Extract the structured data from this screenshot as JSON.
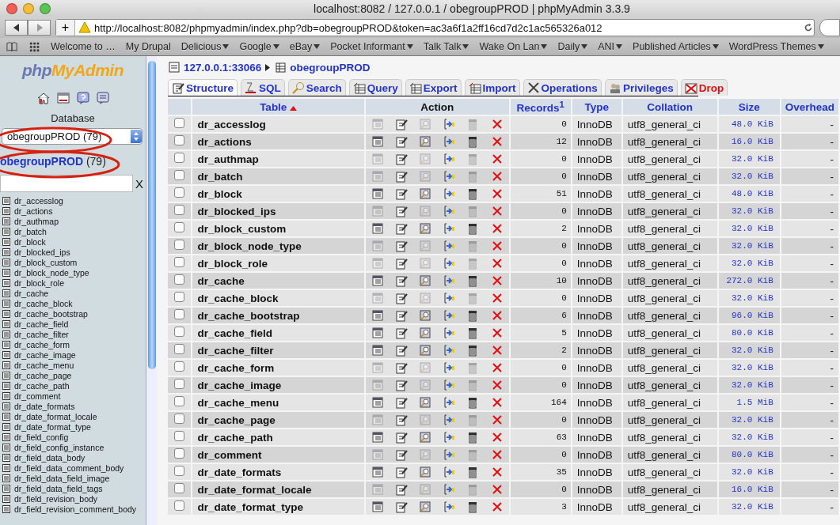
{
  "browser": {
    "title": "localhost:8082 / 127.0.0.1 / obegroupPROD | phpMyAdmin 3.3.9",
    "add_button": "+",
    "url": "http://localhost:8082/phpmyadmin/index.php?db=obegroupPROD&token=ac3a6f1a2ff16cd7d2c1ac565326a012",
    "bookmarks": [
      {
        "label": "Welcome to …",
        "menu": false
      },
      {
        "label": "My Drupal",
        "menu": false
      },
      {
        "label": "Delicious",
        "menu": true
      },
      {
        "label": "Google",
        "menu": true
      },
      {
        "label": "eBay",
        "menu": true
      },
      {
        "label": "Pocket Informant",
        "menu": true
      },
      {
        "label": "Talk Talk",
        "menu": true
      },
      {
        "label": "Wake On Lan",
        "menu": true
      },
      {
        "label": "Daily",
        "menu": true
      },
      {
        "label": "ANI",
        "menu": true
      },
      {
        "label": "Published Articles",
        "menu": true
      },
      {
        "label": "WordPress Themes",
        "menu": true
      }
    ]
  },
  "sidebar": {
    "logo": {
      "php": "php",
      "rest": "MyAdmin"
    },
    "database_label": "Database",
    "database_select": "obegroupPROD (79)",
    "db_link": {
      "name": "obegroupPROD",
      "count": "(79)"
    },
    "filter_clear": "X",
    "tables": [
      "dr_accesslog",
      "dr_actions",
      "dr_authmap",
      "dr_batch",
      "dr_block",
      "dr_blocked_ips",
      "dr_block_custom",
      "dr_block_node_type",
      "dr_block_role",
      "dr_cache",
      "dr_cache_block",
      "dr_cache_bootstrap",
      "dr_cache_field",
      "dr_cache_filter",
      "dr_cache_form",
      "dr_cache_image",
      "dr_cache_menu",
      "dr_cache_page",
      "dr_cache_path",
      "dr_comment",
      "dr_date_formats",
      "dr_date_format_locale",
      "dr_date_format_type",
      "dr_field_config",
      "dr_field_config_instance",
      "dr_field_data_body",
      "dr_field_data_comment_body",
      "dr_field_data_field_image",
      "dr_field_data_field_tags",
      "dr_field_revision_body",
      "dr_field_revision_comment_body"
    ]
  },
  "breadcrumb": {
    "server": "127.0.0.1:33066",
    "database": "obegroupPROD"
  },
  "tabs": [
    {
      "label": "Structure",
      "kind": "structure",
      "selected": true
    },
    {
      "label": "SQL",
      "kind": "sql",
      "selected": false
    },
    {
      "label": "Search",
      "kind": "search",
      "selected": false
    },
    {
      "label": "Query",
      "kind": "query",
      "selected": false
    },
    {
      "label": "Export",
      "kind": "export",
      "selected": false
    },
    {
      "label": "Import",
      "kind": "import",
      "selected": false
    },
    {
      "label": "Operations",
      "kind": "operations",
      "selected": false
    },
    {
      "label": "Privileges",
      "kind": "privileges",
      "selected": false
    },
    {
      "label": "Drop",
      "kind": "drop",
      "selected": false
    }
  ],
  "table": {
    "columns": {
      "table": "Table",
      "action": "Action",
      "records": "Records$^{1}$",
      "type": "Type",
      "collation": "Collation",
      "size": "Size",
      "overhead": "Overhead"
    },
    "rows": [
      {
        "name": "dr_accesslog",
        "empty": true,
        "checked": false,
        "records": "0",
        "type": "InnoDB",
        "collation": "utf8_general_ci",
        "size": "48.0 KiB",
        "overhead": "-"
      },
      {
        "name": "dr_actions",
        "empty": false,
        "checked": false,
        "records": "12",
        "type": "InnoDB",
        "collation": "utf8_general_ci",
        "size": "16.0 KiB",
        "overhead": "-"
      },
      {
        "name": "dr_authmap",
        "empty": true,
        "checked": false,
        "records": "0",
        "type": "InnoDB",
        "collation": "utf8_general_ci",
        "size": "32.0 KiB",
        "overhead": "-"
      },
      {
        "name": "dr_batch",
        "empty": true,
        "checked": false,
        "records": "0",
        "type": "InnoDB",
        "collation": "utf8_general_ci",
        "size": "32.0 KiB",
        "overhead": "-"
      },
      {
        "name": "dr_block",
        "empty": false,
        "checked": false,
        "records": "51",
        "type": "InnoDB",
        "collation": "utf8_general_ci",
        "size": "48.0 KiB",
        "overhead": "-"
      },
      {
        "name": "dr_blocked_ips",
        "empty": true,
        "checked": false,
        "records": "0",
        "type": "InnoDB",
        "collation": "utf8_general_ci",
        "size": "32.0 KiB",
        "overhead": "-"
      },
      {
        "name": "dr_block_custom",
        "empty": false,
        "checked": false,
        "records": "2",
        "type": "InnoDB",
        "collation": "utf8_general_ci",
        "size": "32.0 KiB",
        "overhead": "-"
      },
      {
        "name": "dr_block_node_type",
        "empty": true,
        "checked": false,
        "records": "0",
        "type": "InnoDB",
        "collation": "utf8_general_ci",
        "size": "32.0 KiB",
        "overhead": "-"
      },
      {
        "name": "dr_block_role",
        "empty": true,
        "checked": false,
        "records": "0",
        "type": "InnoDB",
        "collation": "utf8_general_ci",
        "size": "32.0 KiB",
        "overhead": "-"
      },
      {
        "name": "dr_cache",
        "empty": false,
        "checked": false,
        "records": "10",
        "type": "InnoDB",
        "collation": "utf8_general_ci",
        "size": "272.0 KiB",
        "overhead": "-"
      },
      {
        "name": "dr_cache_block",
        "empty": true,
        "checked": false,
        "records": "0",
        "type": "InnoDB",
        "collation": "utf8_general_ci",
        "size": "32.0 KiB",
        "overhead": "-"
      },
      {
        "name": "dr_cache_bootstrap",
        "empty": false,
        "checked": false,
        "records": "6",
        "type": "InnoDB",
        "collation": "utf8_general_ci",
        "size": "96.0 KiB",
        "overhead": "-"
      },
      {
        "name": "dr_cache_field",
        "empty": false,
        "checked": false,
        "records": "5",
        "type": "InnoDB",
        "collation": "utf8_general_ci",
        "size": "80.0 KiB",
        "overhead": "-"
      },
      {
        "name": "dr_cache_filter",
        "empty": false,
        "checked": false,
        "records": "2",
        "type": "InnoDB",
        "collation": "utf8_general_ci",
        "size": "32.0 KiB",
        "overhead": "-"
      },
      {
        "name": "dr_cache_form",
        "empty": true,
        "checked": false,
        "records": "0",
        "type": "InnoDB",
        "collation": "utf8_general_ci",
        "size": "32.0 KiB",
        "overhead": "-"
      },
      {
        "name": "dr_cache_image",
        "empty": true,
        "checked": false,
        "records": "0",
        "type": "InnoDB",
        "collation": "utf8_general_ci",
        "size": "32.0 KiB",
        "overhead": "-"
      },
      {
        "name": "dr_cache_menu",
        "empty": false,
        "checked": false,
        "records": "164",
        "type": "InnoDB",
        "collation": "utf8_general_ci",
        "size": "1.5 MiB",
        "overhead": "-"
      },
      {
        "name": "dr_cache_page",
        "empty": true,
        "checked": false,
        "records": "0",
        "type": "InnoDB",
        "collation": "utf8_general_ci",
        "size": "32.0 KiB",
        "overhead": "-"
      },
      {
        "name": "dr_cache_path",
        "empty": false,
        "checked": false,
        "records": "63",
        "type": "InnoDB",
        "collation": "utf8_general_ci",
        "size": "32.0 KiB",
        "overhead": "-"
      },
      {
        "name": "dr_comment",
        "empty": true,
        "checked": false,
        "records": "0",
        "type": "InnoDB",
        "collation": "utf8_general_ci",
        "size": "80.0 KiB",
        "overhead": "-"
      },
      {
        "name": "dr_date_formats",
        "empty": false,
        "checked": false,
        "records": "35",
        "type": "InnoDB",
        "collation": "utf8_general_ci",
        "size": "32.0 KiB",
        "overhead": "-"
      },
      {
        "name": "dr_date_format_locale",
        "empty": true,
        "checked": false,
        "records": "0",
        "type": "InnoDB",
        "collation": "utf8_general_ci",
        "size": "16.0 KiB",
        "overhead": "-"
      },
      {
        "name": "dr_date_format_type",
        "empty": false,
        "checked": false,
        "records": "3",
        "type": "InnoDB",
        "collation": "utf8_general_ci",
        "size": "32.0 KiB",
        "overhead": "-"
      }
    ]
  }
}
